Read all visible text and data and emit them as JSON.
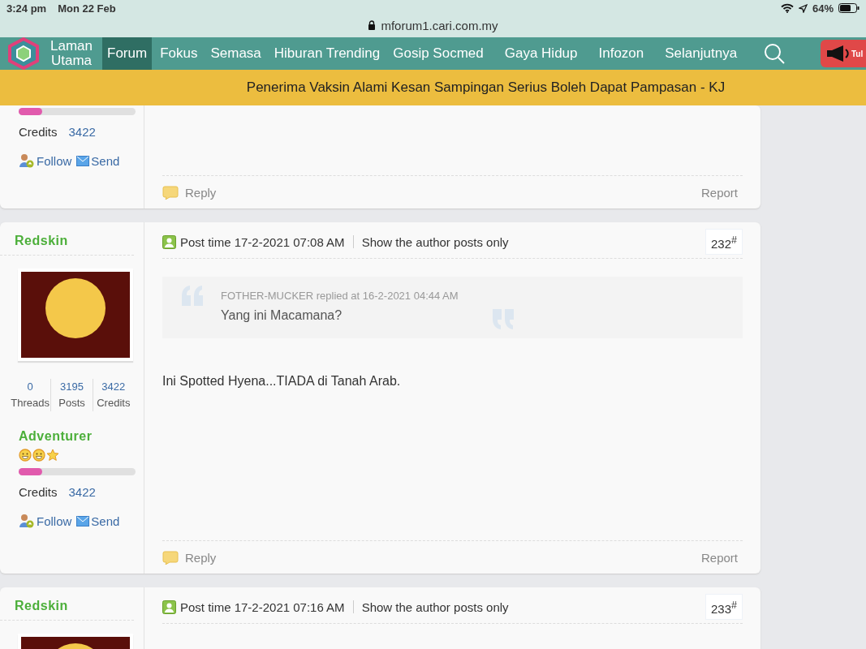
{
  "status_bar": {
    "time": "3:24 pm",
    "date": "Mon 22 Feb",
    "battery": "64%",
    "url": "mforum1.cari.com.my"
  },
  "nav": {
    "home_label": "Laman Utama",
    "items": [
      {
        "label": "Forum",
        "selected": true
      },
      {
        "label": "Fokus",
        "selected": false
      },
      {
        "label": "Semasa",
        "selected": false
      },
      {
        "label": "Hiburan Trending",
        "selected": false
      },
      {
        "label": "Gosip Socmed",
        "selected": false
      },
      {
        "label": "Gaya Hidup",
        "selected": false
      },
      {
        "label": "Infozon",
        "selected": false
      },
      {
        "label": "Selanjutnya",
        "selected": false
      }
    ],
    "promo_label": "Tul"
  },
  "banner": {
    "headline": "Penerima Vaksin Alami Kesan Sampingan Serius Boleh Dapat Pampasan - KJ"
  },
  "posts": [
    {
      "kind": "partial_top",
      "level": 0.2,
      "credits_label": "Credits",
      "credits": "3422",
      "follow": "Follow",
      "send": "Send",
      "reply": "Reply",
      "report": "Report"
    },
    {
      "kind": "full",
      "author": "Redskin",
      "stats": [
        {
          "value": "0",
          "label": "Threads"
        },
        {
          "value": "3195",
          "label": "Posts"
        },
        {
          "value": "3422",
          "label": "Credits"
        }
      ],
      "rank": "Adventurer",
      "rank_icons": [
        {
          "kind": "smiley"
        },
        {
          "kind": "smiley"
        },
        {
          "kind": "star"
        }
      ],
      "level": 0.2,
      "credits_label": "Credits",
      "credits": "3422",
      "follow": "Follow",
      "send": "Send",
      "post_time": "Post time 17-2-2021 07:08 AM",
      "author_only": "Show the author posts only",
      "number": "232$^{#}$",
      "quote_author": "FOTHER-MUCKER replied at 16-2-2021 04:44 AM",
      "quote_text": "Yang ini Macamana?",
      "body": "Ini Spotted Hyena...TIADA di Tanah Arab.",
      "reply": "Reply",
      "report": "Report"
    },
    {
      "kind": "partial_bottom",
      "author": "Redskin",
      "post_time": "Post time 17-2-2021 07:16 AM",
      "author_only": "Show the author posts only",
      "number": "233$^{#}$"
    }
  ]
}
